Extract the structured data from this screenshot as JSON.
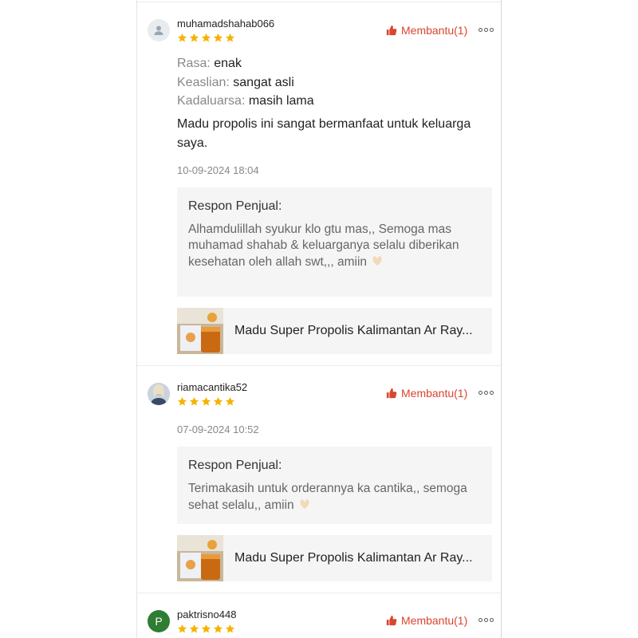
{
  "reviews": [
    {
      "username": "muhamadshahab066",
      "rating": 5,
      "helpful_label": "Membantu(1)",
      "attributes": [
        {
          "label": "Rasa:",
          "value": "enak"
        },
        {
          "label": "Keaslian:",
          "value": "sangat asli"
        },
        {
          "label": "Kadaluarsa:",
          "value": "masih lama"
        }
      ],
      "comment": "Madu propolis ini sangat bermanfaat untuk keluarga saya.",
      "date": "10-09-2024 18:04",
      "response_title": "Respon Penjual:",
      "response_text": "Alhamdulillah syukur klo gtu mas,, Semoga mas muhamad shahab & keluarganya selalu diberikan kesehatan oleh allah swt,,, amiin",
      "product_name": "Madu Super Propolis Kalimantan Ar Ray..."
    },
    {
      "username": "riamacantika52",
      "rating": 5,
      "helpful_label": "Membantu(1)",
      "date": "07-09-2024 10:52",
      "response_title": "Respon Penjual:",
      "response_text": "Terimakasih untuk orderannya ka cantika,, semoga sehat selalu,, amiin",
      "product_name": "Madu Super Propolis Kalimantan Ar Ray..."
    },
    {
      "username": "paktrisno448",
      "avatar_letter": "P",
      "rating": 5,
      "helpful_label": "Membantu(1)"
    }
  ],
  "colors": {
    "accent": "#d9452f",
    "star": "#f5b301",
    "muted": "#888888",
    "response_bg": "#f5f5f5"
  },
  "icons": [
    "user-icon",
    "star-icon",
    "thumbs-up-icon",
    "more-options-icon",
    "praying-hands-icon"
  ]
}
